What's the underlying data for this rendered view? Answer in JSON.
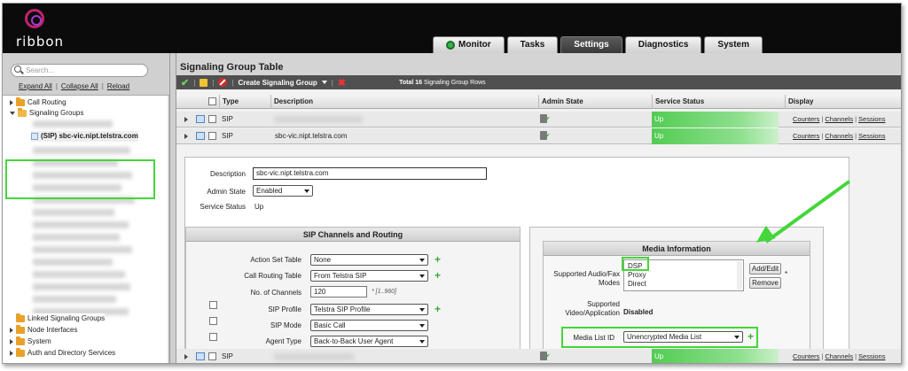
{
  "app": {
    "logo_text": "ribbon"
  },
  "tabs": [
    {
      "label": "Monitor"
    },
    {
      "label": "Tasks"
    },
    {
      "label": "Settings"
    },
    {
      "label": "Diagnostics"
    },
    {
      "label": "System"
    }
  ],
  "leftnav": {
    "search_placeholder": "Search...",
    "expand_all": "Expand All",
    "collapse_all": "Collapse All",
    "reload": "Reload",
    "separator": "|",
    "tree": {
      "call_routing": "Call Routing",
      "signaling_groups": "Signaling Groups",
      "selected_group": "(SIP) sbc-vic.nipt.telstra.com",
      "linked_signaling_groups": "Linked Signaling Groups",
      "node_interfaces": "Node Interfaces",
      "system": "System",
      "auth_directory": "Auth and Directory Services"
    }
  },
  "main": {
    "title": "Signaling Group Table",
    "toolbar": {
      "create_label": "Create Signaling Group",
      "total_text": "Total",
      "total_count": "16",
      "total_suffix": "Signaling Group Rows"
    },
    "columns": {
      "type": "Type",
      "description": "Description",
      "admin_state": "Admin State",
      "service_status": "Service Status",
      "display": "Display"
    },
    "rows": [
      {
        "type": "SIP",
        "description": "",
        "status": "Up"
      },
      {
        "type": "SIP",
        "description": "sbc-vic.nipt.telstra.com",
        "status": "Up"
      },
      {
        "type": "SIP",
        "description": "",
        "status": "Up"
      }
    ],
    "display_links": {
      "counters": "Counters",
      "channels": "Channels",
      "sessions": "Sessions",
      "sep": "|"
    }
  },
  "detail": {
    "description_label": "Description",
    "description_value": "sbc-vic.nipt.telstra.com",
    "admin_state_label": "Admin State",
    "admin_state_value": "Enabled",
    "service_status_label": "Service Status",
    "service_status_value": "Up"
  },
  "sip_panel": {
    "title": "SIP Channels and Routing",
    "action_set_table_label": "Action Set Table",
    "action_set_table_value": "None",
    "call_routing_table_label": "Call Routing Table",
    "call_routing_table_value": "From Telstra SIP",
    "channels_label": "No. of Channels",
    "channels_value": "120",
    "channels_hint": "* [1..960]",
    "sip_profile_label": "SIP Profile",
    "sip_profile_value": "Telstra SIP Profile",
    "sip_mode_label": "SIP Mode",
    "sip_mode_value": "Basic Call",
    "agent_type_label": "Agent Type",
    "agent_type_value": "Back-to-Back User Agent"
  },
  "media_panel": {
    "title": "Media Information",
    "audio_fax_label": "Supported Audio/Fax Modes",
    "audio_fax_options": [
      "DSP",
      "Proxy",
      "Direct"
    ],
    "add_edit": "Add/Edit",
    "remove": "Remove",
    "asterisk": "*",
    "video_app_label": "Supported Video/Application Modes",
    "video_app_value": "Disabled",
    "media_list_label": "Media List ID",
    "media_list_value": "Unencrypted Media List"
  },
  "colors": {
    "accent_green": "#44d63a",
    "status_up": "#52cc52",
    "brand_magenta": "#c1236a"
  }
}
